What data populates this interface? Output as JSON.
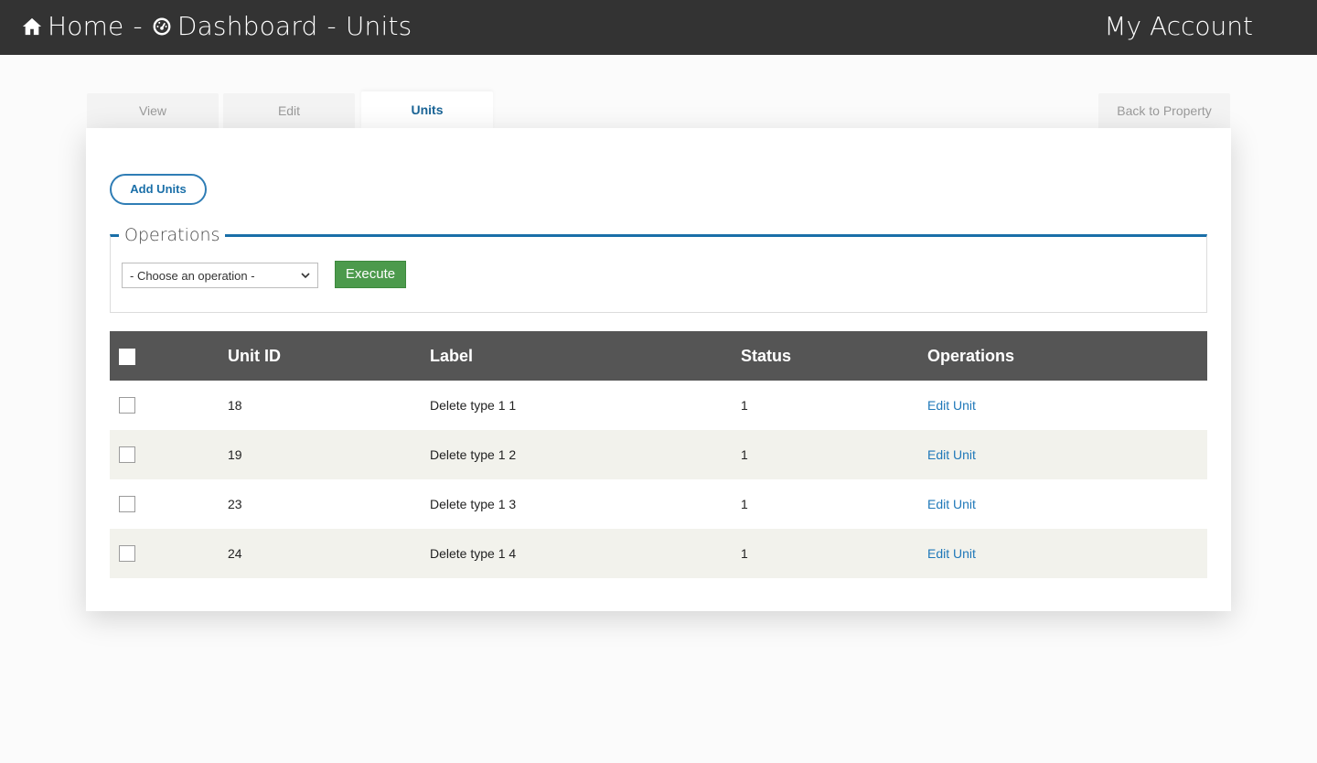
{
  "header": {
    "home_label": "Home",
    "separator": "-",
    "dashboard_label": "Dashboard",
    "page_label": "Units",
    "account_label": "My Account"
  },
  "tabs": {
    "view": "View",
    "edit": "Edit",
    "units": "Units",
    "back": "Back to Property"
  },
  "actions": {
    "add_units": "Add Units"
  },
  "operations": {
    "legend": "Operations",
    "select_value": "- Choose an operation -",
    "execute_label": "Execute"
  },
  "table": {
    "columns": [
      "Unit ID",
      "Label",
      "Status",
      "Operations"
    ],
    "rows": [
      {
        "id": "18",
        "label": "Delete type 1 1",
        "status": "1",
        "op": "Edit Unit"
      },
      {
        "id": "19",
        "label": "Delete type 1 2",
        "status": "1",
        "op": "Edit Unit"
      },
      {
        "id": "23",
        "label": "Delete type 1 3",
        "status": "1",
        "op": "Edit Unit"
      },
      {
        "id": "24",
        "label": "Delete type 1 4",
        "status": "1",
        "op": "Edit Unit"
      }
    ]
  }
}
